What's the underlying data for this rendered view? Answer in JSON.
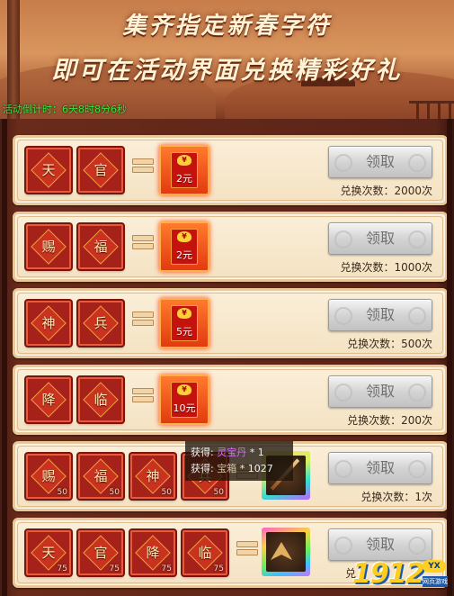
{
  "banner": {
    "line1": "集齐指定新春字符",
    "line2": "即可在活动界面兑换精彩好礼",
    "countdown": "活动倒计时：6天8时8分6秒"
  },
  "rows": [
    {
      "cards": [
        {
          "char": "天"
        },
        {
          "char": "官"
        }
      ],
      "reward": {
        "type": "red-envelope",
        "amount": "2元"
      },
      "button": "领取",
      "times": "兑换次数：2000次"
    },
    {
      "cards": [
        {
          "char": "赐"
        },
        {
          "char": "福"
        }
      ],
      "reward": {
        "type": "red-envelope",
        "amount": "2元"
      },
      "button": "领取",
      "times": "兑换次数：1000次"
    },
    {
      "cards": [
        {
          "char": "神"
        },
        {
          "char": "兵"
        }
      ],
      "reward": {
        "type": "red-envelope",
        "amount": "5元"
      },
      "button": "领取",
      "times": "兑换次数：500次"
    },
    {
      "cards": [
        {
          "char": "降"
        },
        {
          "char": "临"
        }
      ],
      "reward": {
        "type": "red-envelope",
        "amount": "10元"
      },
      "button": "领取",
      "times": "兑换次数：200次"
    },
    {
      "cards": [
        {
          "char": "赐",
          "count": "50"
        },
        {
          "char": "福",
          "count": "50"
        },
        {
          "char": "神",
          "count": "50"
        },
        {
          "char": "兵",
          "count": "50"
        }
      ],
      "reward": {
        "type": "item",
        "icon": "spear-icon"
      },
      "button": "领取",
      "times": "兑换次数：1次"
    },
    {
      "cards": [
        {
          "char": "天",
          "count": "75"
        },
        {
          "char": "官",
          "count": "75"
        },
        {
          "char": "降",
          "count": "75"
        },
        {
          "char": "临",
          "count": "75"
        }
      ],
      "reward": {
        "type": "item",
        "icon": "winged-armor-icon"
      },
      "button": "领取",
      "times": "兑"
    }
  ],
  "tooltip": {
    "line1_prefix": "获得:",
    "line1_item": "灵宝丹",
    "line1_qty": "* 1",
    "line2_prefix": "获得:",
    "line2_item": "宝箱",
    "line2_qty": "* 1027"
  },
  "logo": {
    "number": "1912",
    "badge": "YX",
    "sub": "网页游戏"
  }
}
